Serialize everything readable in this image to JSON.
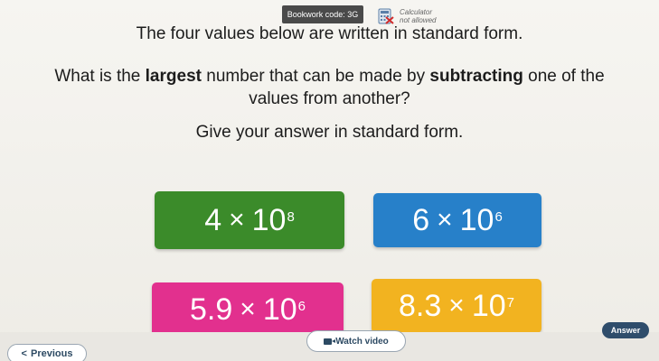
{
  "header": {
    "bookwork_code": "Bookwork code: 3G",
    "calculator_line1": "Calculator",
    "calculator_line2": "not allowed"
  },
  "question": {
    "line1": "The four values below are written in standard form.",
    "line2_before": "What is the ",
    "line2_bold1": "largest",
    "line2_middle": " number that can be made by ",
    "line2_bold2": "subtracting",
    "line2_after": " one of the",
    "line3": "values from another?",
    "line4": "Give your answer in standard form."
  },
  "values": [
    {
      "coefficient": "4",
      "times": "×",
      "base": "10",
      "exponent": "8",
      "color": "#3b8b2a"
    },
    {
      "coefficient": "6",
      "times": "×",
      "base": "10",
      "exponent": "6",
      "color": "#2780c9"
    },
    {
      "coefficient": "5.9",
      "times": "×",
      "base": "10",
      "exponent": "6",
      "color": "#e2308e"
    },
    {
      "coefficient": "8.3",
      "times": "×",
      "base": "10",
      "exponent": "7",
      "color": "#f2b320"
    }
  ],
  "buttons": {
    "previous": "Previous",
    "previous_chevron": "<",
    "watch_video": "Watch video",
    "answer": "Answer"
  }
}
